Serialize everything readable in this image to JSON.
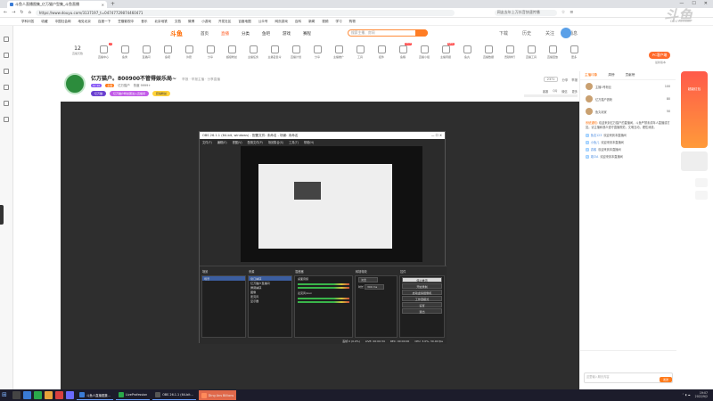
{
  "browser": {
    "tab_title": "斗鱼人直播图集_亿万猫户型集_斗鱼直播",
    "url": "https://www.douyu.com/3137197_t=04747729874460471",
    "search_placeholder": "网友去年上万抖音快速传播",
    "bookmarks": [
      "学科问答",
      "收藏",
      "中国社会网",
      "地处北京",
      "百度一下",
      "豆瓣影视中",
      "音乐",
      "北京地铁",
      "文档",
      "微博",
      "小游戏",
      "开发社区",
      "百度地图",
      "公众号",
      "网页游戏",
      "百科",
      "新闻",
      "视频",
      "学习",
      "购物"
    ]
  },
  "douyu": {
    "logo": "斗鱼",
    "nav_links": [
      "首页",
      "直播",
      "分类",
      "鱼吧",
      "游戏",
      "赛程"
    ],
    "active_nav": "直播",
    "search_placeholder": "搜索主播、房间",
    "right_items": [
      "下载",
      "历史",
      "关注",
      "消息"
    ],
    "tools": [
      {
        "label": "直播中心",
        "badge": "1"
      },
      {
        "label": "鱼秀",
        "badge": ""
      },
      {
        "label": "直播间",
        "badge": ""
      },
      {
        "label": "鱼吧",
        "badge": ""
      },
      {
        "label": "许愿",
        "badge": ""
      },
      {
        "label": "分享",
        "badge": ""
      },
      {
        "label": "超级粉丝",
        "badge": ""
      },
      {
        "label": "主播任务",
        "badge": ""
      },
      {
        "label": "主播召集令",
        "badge": ""
      },
      {
        "label": "直播计划",
        "badge": ""
      },
      {
        "label": "分享",
        "badge": ""
      },
      {
        "label": "主播推广",
        "badge": ""
      },
      {
        "label": "工具",
        "badge": ""
      },
      {
        "label": "挂件",
        "badge": ""
      },
      {
        "label": "鱼粮",
        "badge": "HOT"
      },
      {
        "label": "直播小组",
        "badge": ""
      },
      {
        "label": "主播周报",
        "badge": "NEW"
      },
      {
        "label": "鱼丸",
        "badge": ""
      },
      {
        "label": "直播数据",
        "badge": ""
      },
      {
        "label": "贡献排行",
        "badge": ""
      },
      {
        "label": "直播工具",
        "badge": ""
      },
      {
        "label": "直播回放",
        "badge": ""
      },
      {
        "label": "更多",
        "badge": ""
      }
    ],
    "counter_value": "12",
    "counter_label": "直播天数",
    "pc_button": "PC客户端",
    "beta_text": "最新版本"
  },
  "room": {
    "title": "亿万猫户。800900不管得娱乐局~",
    "subtitle": "举报 · 举报主播 · 分享直播",
    "tag1": "LV 10",
    "tag2": "主播",
    "category": "亿万猫户",
    "hot_text": "热度 9999+",
    "pill1": "亿万猫",
    "pill2": "亿万猫户粉丝团进入直播间",
    "pill3": "获得粉丝",
    "follow_label": "关注",
    "follow_count": "2371",
    "share_label": "分享",
    "report_label": "举报",
    "stat_items": [
      "客服",
      "QQ",
      "微信",
      "更多"
    ]
  },
  "obs": {
    "title": "OBS 26.1.1 (64-bit, windows) - 配置文件: 未命名 - 场景: 未命名",
    "menu": [
      "文件(F)",
      "编辑(E)",
      "视图(V)",
      "配置文件(P)",
      "场景集合(S)",
      "工具(T)",
      "帮助(H)"
    ],
    "scenes_label": "场景",
    "scene_item": "场景",
    "sources_label": "来源",
    "sources": [
      "窗口捕获",
      "亿万猫户直播间",
      "屏幕捕获",
      "图像",
      "麦克风",
      "显示器"
    ],
    "mixer_label": "混音器",
    "mixer_items": [
      "桌面音频",
      "麦克风/Aux"
    ],
    "transition_label": "转场特效",
    "transition_value": "淡出",
    "duration_label": "时长",
    "duration_value": "300 ms",
    "controls_label": "控件",
    "controls": [
      "停止推流",
      "开始录制",
      "启动虚拟摄像机",
      "工作室模式",
      "设置",
      "退出"
    ],
    "status": [
      "丢帧 0 (0.0%)",
      "LIVE: 00:00:34",
      "REC: 00:00:00",
      "CPU: 3.0%, 30.00 fps"
    ]
  },
  "chat": {
    "tabs": [
      "主播印象",
      "周榜",
      "贡献榜"
    ],
    "ranking": [
      {
        "name": "主播1号粉丝",
        "value": "100"
      },
      {
        "name": "亿万猫户铁粉",
        "value": "80"
      },
      {
        "name": "鱼丸玩家",
        "value": "50"
      }
    ],
    "notice_title": "系统通知:",
    "notice_text": "欢迎来到亿万猫户的直播间，斗鱼严禁未成年人直播或打赏。请主播和观众遵守直播规范，文明互动，理性消费。",
    "messages": [
      {
        "level": "1",
        "name": "鱼友123",
        "text": "欢迎来到本直播间"
      },
      {
        "level": "3",
        "name": "小鱼儿",
        "text": "欢迎来到本直播间"
      },
      {
        "level": "2",
        "name": "游客",
        "text": "欢迎来到本直播间"
      },
      {
        "level": "5",
        "name": "观众A",
        "text": "欢迎来到本直播间"
      }
    ],
    "input_placeholder": "这里输入聊天内容",
    "send_label": "发送"
  },
  "watermark": {
    "text": "斗鱼",
    "sub": "DOUYU.COM"
  },
  "gift_ad": "超级红包",
  "taskbar": {
    "apps": [
      "斗鱼人直播图集...",
      "LiveProfession",
      "OBS 26.1.1 (64-bit...",
      "Ding Ans Billions"
    ],
    "time": "19:07",
    "date": "2022/9/2"
  },
  "colors": {
    "accent": "#ff6a00",
    "player_bg": "#2e2e2e",
    "obs_bg": "#2b2b2b",
    "taskbar": "#1c1c2b"
  }
}
